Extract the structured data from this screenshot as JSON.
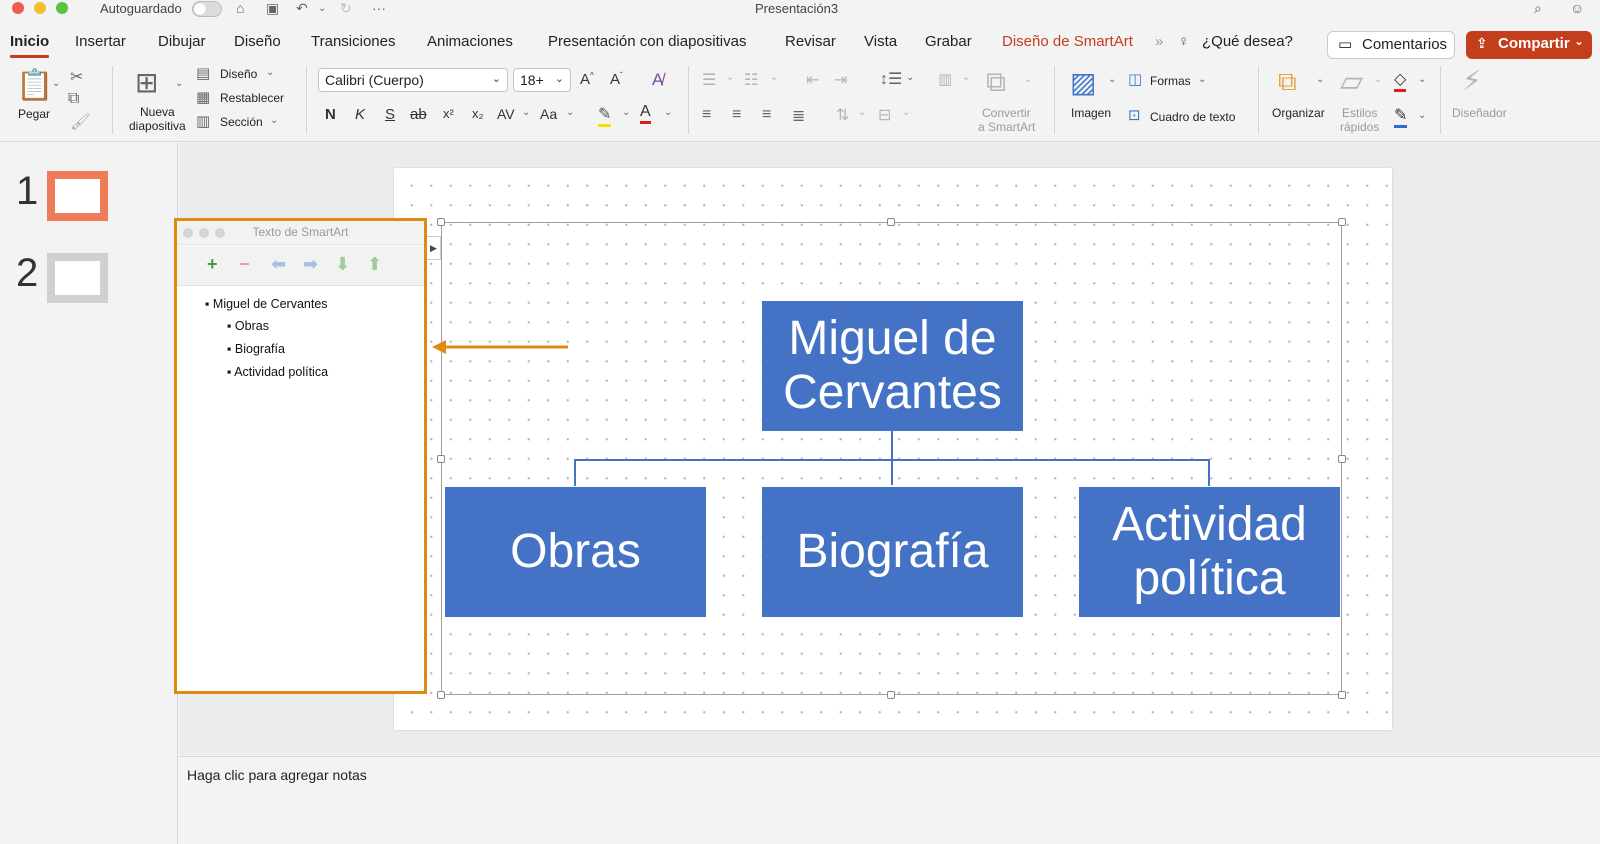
{
  "titlebar": {
    "autosave_label": "Autoguardado",
    "doc_title": "Presentación3"
  },
  "tabs": [
    {
      "label": "Inicio"
    },
    {
      "label": "Insertar"
    },
    {
      "label": "Dibujar"
    },
    {
      "label": "Diseño"
    },
    {
      "label": "Transiciones"
    },
    {
      "label": "Animaciones"
    },
    {
      "label": "Presentación con diapositivas"
    },
    {
      "label": "Revisar"
    },
    {
      "label": "Vista"
    },
    {
      "label": "Grabar"
    },
    {
      "label": "Diseño de SmartArt"
    }
  ],
  "tell_me": "¿Qué desea?",
  "comments_label": "Comentarios",
  "share_label": "Compartir",
  "ribbon": {
    "paste": "Pegar",
    "new_slide_l1": "Nueva",
    "new_slide_l2": "diapositiva",
    "layout": "Diseño",
    "reset": "Restablecer",
    "section": "Sección",
    "font_name": "Calibri (Cuerpo)",
    "font_size": "18+",
    "bold": "N",
    "italic": "K",
    "underline": "S",
    "strike": "ab",
    "superscript": "x²",
    "subscript": "x₂",
    "spacing": "AV",
    "case": "Aa",
    "convert_l1": "Convertir",
    "convert_l2": "a SmartArt",
    "picture": "Imagen",
    "shapes": "Formas",
    "textbox": "Cuadro de texto",
    "arrange": "Organizar",
    "quick_styles_l1": "Estilos",
    "quick_styles_l2": "rápidos",
    "designer": "Diseñador"
  },
  "slides": [
    {
      "number": "1",
      "selected": true
    },
    {
      "number": "2",
      "selected": false
    }
  ],
  "text_pane": {
    "title": "Texto de SmartArt",
    "items": [
      "Miguel de Cervantes",
      "Obras",
      "Biografía",
      "Actividad política"
    ]
  },
  "smartart": {
    "top_l1": "Miguel de",
    "top_l2": "Cervantes",
    "child1": "Obras",
    "child2": "Biografía",
    "child3_l1": "Actividad",
    "child3_l2": "política",
    "fill_color": "#4472c4"
  },
  "notes_placeholder": "Haga clic para agregar notas",
  "colors": {
    "accent": "#c43e1c",
    "highlight_border": "#e08a12",
    "thumb_selected": "#ef7c58"
  }
}
